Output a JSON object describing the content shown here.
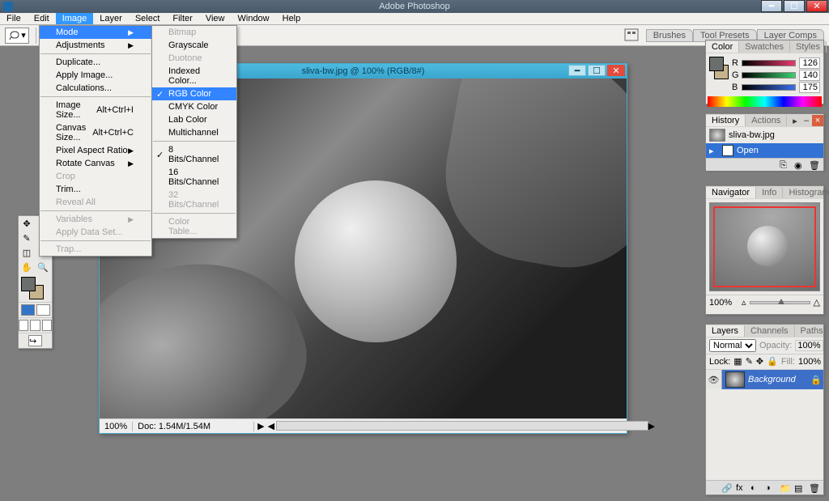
{
  "app": {
    "title": "Adobe Photoshop"
  },
  "menubar": [
    "File",
    "Edit",
    "Image",
    "Layer",
    "Select",
    "Filter",
    "View",
    "Window",
    "Help"
  ],
  "active_menu_index": 2,
  "image_menu": {
    "items": [
      {
        "label": "Mode",
        "arrow": true,
        "highlight": true
      },
      {
        "label": "Adjustments",
        "arrow": true
      },
      {
        "sep": true
      },
      {
        "label": "Duplicate..."
      },
      {
        "label": "Apply Image..."
      },
      {
        "label": "Calculations..."
      },
      {
        "sep": true
      },
      {
        "label": "Image Size...",
        "shortcut": "Alt+Ctrl+I"
      },
      {
        "label": "Canvas Size...",
        "shortcut": "Alt+Ctrl+C"
      },
      {
        "label": "Pixel Aspect Ratio",
        "arrow": true
      },
      {
        "label": "Rotate Canvas",
        "arrow": true
      },
      {
        "label": "Crop",
        "disabled": true
      },
      {
        "label": "Trim..."
      },
      {
        "label": "Reveal All",
        "disabled": true
      },
      {
        "sep": true
      },
      {
        "label": "Variables",
        "arrow": true,
        "disabled": true
      },
      {
        "label": "Apply Data Set...",
        "disabled": true
      },
      {
        "sep": true
      },
      {
        "label": "Trap...",
        "disabled": true
      }
    ]
  },
  "mode_submenu": {
    "items": [
      {
        "label": "Bitmap",
        "disabled": true
      },
      {
        "label": "Grayscale"
      },
      {
        "label": "Duotone",
        "disabled": true
      },
      {
        "label": "Indexed Color..."
      },
      {
        "label": "RGB Color",
        "checked": true,
        "highlight": true
      },
      {
        "label": "CMYK Color"
      },
      {
        "label": "Lab Color"
      },
      {
        "label": "Multichannel"
      },
      {
        "sep": true
      },
      {
        "label": "8 Bits/Channel",
        "checked": true
      },
      {
        "label": "16 Bits/Channel"
      },
      {
        "label": "32 Bits/Channel",
        "disabled": true
      },
      {
        "sep": true
      },
      {
        "label": "Color Table...",
        "disabled": true
      }
    ]
  },
  "options_tabs": [
    "Brushes",
    "Tool Presets",
    "Layer Comps"
  ],
  "document": {
    "title": "sliva-bw.jpg @ 100% (RGB/8#)",
    "zoom": "100%",
    "docsize": "Doc: 1.54M/1.54M"
  },
  "panels": {
    "color": {
      "tabs": [
        "Color",
        "Swatches",
        "Styles"
      ],
      "channels": [
        {
          "label": "R",
          "value": "126"
        },
        {
          "label": "G",
          "value": "140"
        },
        {
          "label": "B",
          "value": "175"
        }
      ]
    },
    "history": {
      "tabs": [
        "History",
        "Actions"
      ],
      "snapshot": "sliva-bw.jpg",
      "state": "Open"
    },
    "navigator": {
      "tabs": [
        "Navigator",
        "Info",
        "Histogram"
      ],
      "zoom": "100%"
    },
    "layers": {
      "tabs": [
        "Layers",
        "Channels",
        "Paths"
      ],
      "blend": "Normal",
      "opacity_label": "Opacity:",
      "opacity": "100%",
      "lock_label": "Lock:",
      "fill_label": "Fill:",
      "fill": "100%",
      "layer_name": "Background"
    }
  }
}
